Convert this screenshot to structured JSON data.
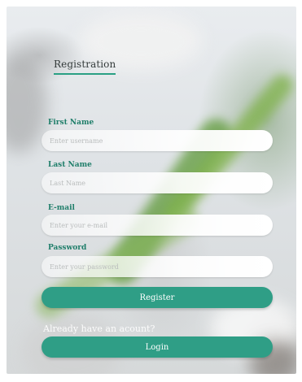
{
  "registration": {
    "title": "Registration",
    "accent_color": "#2f9e86",
    "label_color": "#1f7e6a"
  },
  "fields": {
    "first_name": {
      "label": "First Name",
      "placeholder": "Enter username",
      "value": ""
    },
    "last_name": {
      "label": "Last Name",
      "placeholder": "Last Name",
      "value": ""
    },
    "email": {
      "label": "E-mail",
      "placeholder": "Enter your e-mail",
      "value": ""
    },
    "password": {
      "label": "Password",
      "placeholder": "Enter your password",
      "value": ""
    }
  },
  "actions": {
    "register_label": "Register",
    "already_text": "Already have an acount?",
    "login_label": "Login"
  }
}
